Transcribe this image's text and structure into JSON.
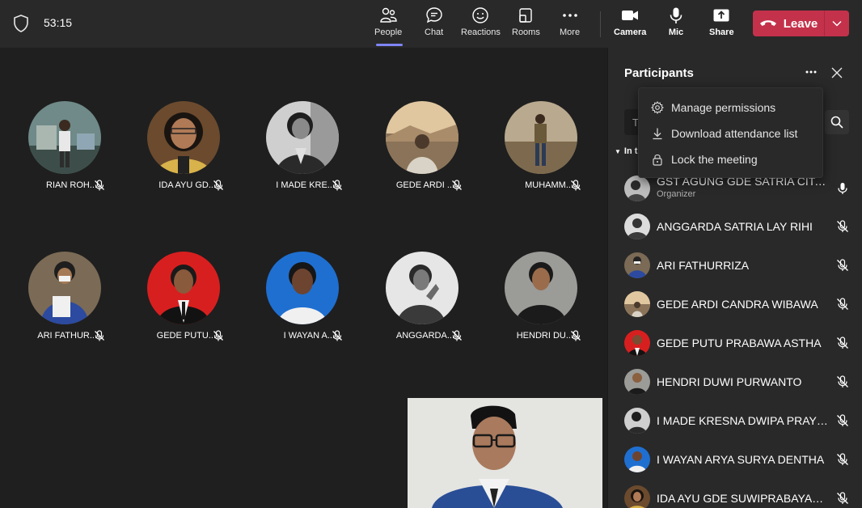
{
  "topbar": {
    "timer": "53:15",
    "buttons": {
      "people": "People",
      "chat": "Chat",
      "reactions": "Reactions",
      "rooms": "Rooms",
      "more": "More",
      "camera": "Camera",
      "mic": "Mic",
      "share": "Share"
    },
    "leave_label": "Leave",
    "accent_color": "#7f85f5",
    "leave_color": "#c4314b"
  },
  "stage": {
    "tiles": [
      {
        "name": "RIAN ROH...",
        "muted": true
      },
      {
        "name": "IDA AYU GD...",
        "muted": true
      },
      {
        "name": "I MADE KRE...",
        "muted": true
      },
      {
        "name": "GEDE ARDI ...",
        "muted": true
      },
      {
        "name": "MUHAMM...",
        "muted": true
      },
      {
        "name": "ARI FATHUR...",
        "muted": true
      },
      {
        "name": "GEDE PUTU...",
        "muted": true
      },
      {
        "name": "I WAYAN A...",
        "muted": true
      },
      {
        "name": "ANGGARDA...",
        "muted": true
      },
      {
        "name": "HENDRI DU...",
        "muted": true
      }
    ]
  },
  "panel": {
    "title": "Participants",
    "search_placeholder": "T",
    "section_label": "In t",
    "participants": [
      {
        "name": "GST AGUNG GDE SATRIA CITA P...",
        "role": "Organizer",
        "mic": "on"
      },
      {
        "name": "ANGGARDA SATRIA LAY RIHI",
        "mic": "muted"
      },
      {
        "name": "ARI FATHURRIZA",
        "mic": "muted"
      },
      {
        "name": "GEDE ARDI CANDRA WIBAWA",
        "mic": "muted"
      },
      {
        "name": "GEDE PUTU PRABAWA ASTHA",
        "mic": "muted"
      },
      {
        "name": "HENDRI DUWI PURWANTO",
        "mic": "muted"
      },
      {
        "name": "I MADE KRESNA DWIPA PRAYOGA",
        "mic": "muted"
      },
      {
        "name": "I WAYAN ARYA SURYA DENTHA",
        "mic": "muted"
      },
      {
        "name": "IDA AYU GDE SUWIPRABAYANTI...",
        "mic": "muted"
      }
    ]
  },
  "menu": {
    "items": [
      {
        "label": "Manage permissions",
        "icon": "gear-icon"
      },
      {
        "label": "Download attendance list",
        "icon": "download-icon"
      },
      {
        "label": "Lock the meeting",
        "icon": "lock-icon"
      }
    ]
  }
}
